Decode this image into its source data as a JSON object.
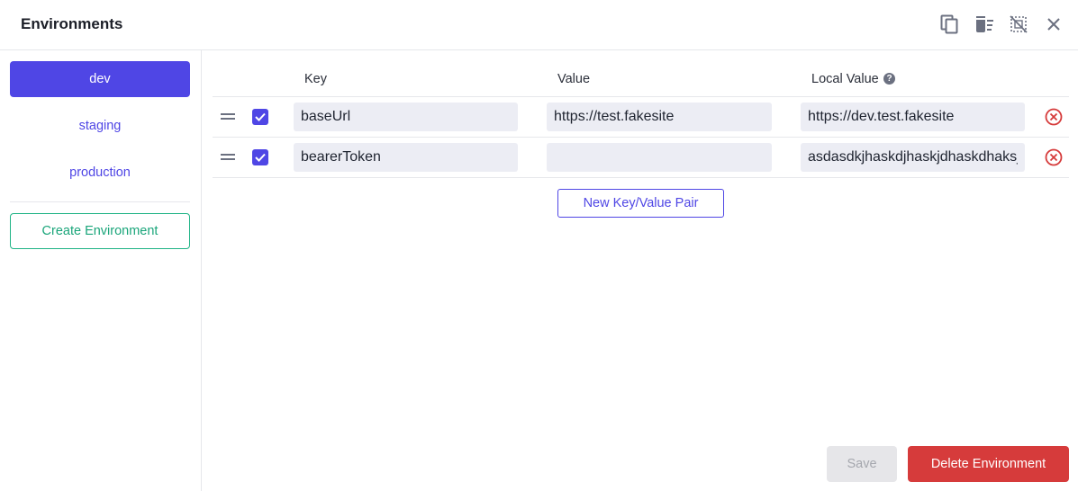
{
  "header": {
    "title": "Environments",
    "icons": [
      "copy-icon",
      "delete-all-icon",
      "deselect-icon",
      "close-icon"
    ]
  },
  "sidebar": {
    "environments": [
      {
        "label": "dev",
        "active": true
      },
      {
        "label": "staging",
        "active": false
      },
      {
        "label": "production",
        "active": false
      }
    ],
    "create_label": "Create Environment"
  },
  "table": {
    "headers": {
      "key": "Key",
      "value": "Value",
      "local_value": "Local Value"
    },
    "rows": [
      {
        "enabled": true,
        "key": "baseUrl",
        "value": "https://test.fakesite",
        "local_value": "https://dev.test.fakesite"
      },
      {
        "enabled": true,
        "key": "bearerToken",
        "value": "",
        "local_value": "asdasdkjhaskdjhaskjdhaskdhaksjdh"
      }
    ],
    "new_pair_label": "New Key/Value Pair"
  },
  "footer": {
    "save_label": "Save",
    "delete_label": "Delete Environment"
  },
  "colors": {
    "accent": "#4f46e5",
    "create": "#20b486",
    "danger": "#d63b3b",
    "disabled": "#e6e6e9"
  }
}
